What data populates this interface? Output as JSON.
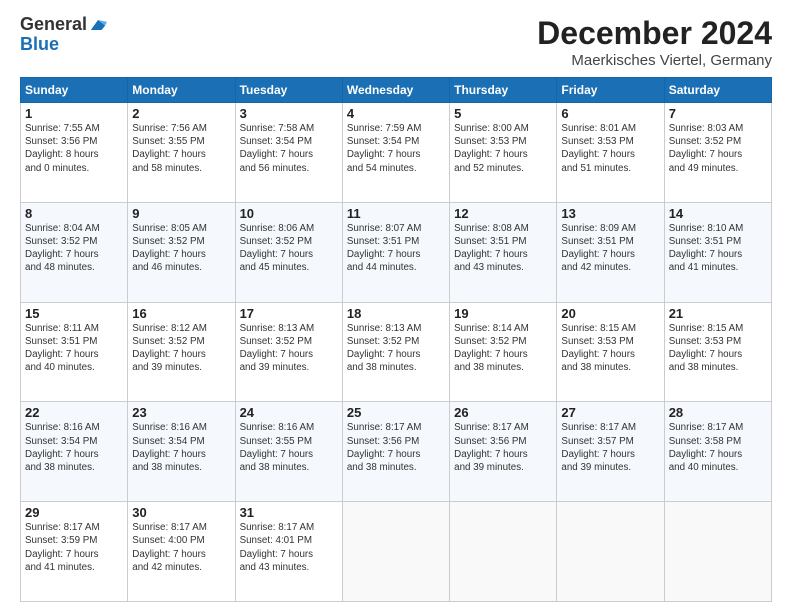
{
  "header": {
    "logo_general": "General",
    "logo_blue": "Blue",
    "main_title": "December 2024",
    "subtitle": "Maerkisches Viertel, Germany"
  },
  "weekdays": [
    "Sunday",
    "Monday",
    "Tuesday",
    "Wednesday",
    "Thursday",
    "Friday",
    "Saturday"
  ],
  "weeks": [
    [
      {
        "day": 1,
        "info": "Sunrise: 7:55 AM\nSunset: 3:56 PM\nDaylight: 8 hours\nand 0 minutes."
      },
      {
        "day": 2,
        "info": "Sunrise: 7:56 AM\nSunset: 3:55 PM\nDaylight: 7 hours\nand 58 minutes."
      },
      {
        "day": 3,
        "info": "Sunrise: 7:58 AM\nSunset: 3:54 PM\nDaylight: 7 hours\nand 56 minutes."
      },
      {
        "day": 4,
        "info": "Sunrise: 7:59 AM\nSunset: 3:54 PM\nDaylight: 7 hours\nand 54 minutes."
      },
      {
        "day": 5,
        "info": "Sunrise: 8:00 AM\nSunset: 3:53 PM\nDaylight: 7 hours\nand 52 minutes."
      },
      {
        "day": 6,
        "info": "Sunrise: 8:01 AM\nSunset: 3:53 PM\nDaylight: 7 hours\nand 51 minutes."
      },
      {
        "day": 7,
        "info": "Sunrise: 8:03 AM\nSunset: 3:52 PM\nDaylight: 7 hours\nand 49 minutes."
      }
    ],
    [
      {
        "day": 8,
        "info": "Sunrise: 8:04 AM\nSunset: 3:52 PM\nDaylight: 7 hours\nand 48 minutes."
      },
      {
        "day": 9,
        "info": "Sunrise: 8:05 AM\nSunset: 3:52 PM\nDaylight: 7 hours\nand 46 minutes."
      },
      {
        "day": 10,
        "info": "Sunrise: 8:06 AM\nSunset: 3:52 PM\nDaylight: 7 hours\nand 45 minutes."
      },
      {
        "day": 11,
        "info": "Sunrise: 8:07 AM\nSunset: 3:51 PM\nDaylight: 7 hours\nand 44 minutes."
      },
      {
        "day": 12,
        "info": "Sunrise: 8:08 AM\nSunset: 3:51 PM\nDaylight: 7 hours\nand 43 minutes."
      },
      {
        "day": 13,
        "info": "Sunrise: 8:09 AM\nSunset: 3:51 PM\nDaylight: 7 hours\nand 42 minutes."
      },
      {
        "day": 14,
        "info": "Sunrise: 8:10 AM\nSunset: 3:51 PM\nDaylight: 7 hours\nand 41 minutes."
      }
    ],
    [
      {
        "day": 15,
        "info": "Sunrise: 8:11 AM\nSunset: 3:51 PM\nDaylight: 7 hours\nand 40 minutes."
      },
      {
        "day": 16,
        "info": "Sunrise: 8:12 AM\nSunset: 3:52 PM\nDaylight: 7 hours\nand 39 minutes."
      },
      {
        "day": 17,
        "info": "Sunrise: 8:13 AM\nSunset: 3:52 PM\nDaylight: 7 hours\nand 39 minutes."
      },
      {
        "day": 18,
        "info": "Sunrise: 8:13 AM\nSunset: 3:52 PM\nDaylight: 7 hours\nand 38 minutes."
      },
      {
        "day": 19,
        "info": "Sunrise: 8:14 AM\nSunset: 3:52 PM\nDaylight: 7 hours\nand 38 minutes."
      },
      {
        "day": 20,
        "info": "Sunrise: 8:15 AM\nSunset: 3:53 PM\nDaylight: 7 hours\nand 38 minutes."
      },
      {
        "day": 21,
        "info": "Sunrise: 8:15 AM\nSunset: 3:53 PM\nDaylight: 7 hours\nand 38 minutes."
      }
    ],
    [
      {
        "day": 22,
        "info": "Sunrise: 8:16 AM\nSunset: 3:54 PM\nDaylight: 7 hours\nand 38 minutes."
      },
      {
        "day": 23,
        "info": "Sunrise: 8:16 AM\nSunset: 3:54 PM\nDaylight: 7 hours\nand 38 minutes."
      },
      {
        "day": 24,
        "info": "Sunrise: 8:16 AM\nSunset: 3:55 PM\nDaylight: 7 hours\nand 38 minutes."
      },
      {
        "day": 25,
        "info": "Sunrise: 8:17 AM\nSunset: 3:56 PM\nDaylight: 7 hours\nand 38 minutes."
      },
      {
        "day": 26,
        "info": "Sunrise: 8:17 AM\nSunset: 3:56 PM\nDaylight: 7 hours\nand 39 minutes."
      },
      {
        "day": 27,
        "info": "Sunrise: 8:17 AM\nSunset: 3:57 PM\nDaylight: 7 hours\nand 39 minutes."
      },
      {
        "day": 28,
        "info": "Sunrise: 8:17 AM\nSunset: 3:58 PM\nDaylight: 7 hours\nand 40 minutes."
      }
    ],
    [
      {
        "day": 29,
        "info": "Sunrise: 8:17 AM\nSunset: 3:59 PM\nDaylight: 7 hours\nand 41 minutes."
      },
      {
        "day": 30,
        "info": "Sunrise: 8:17 AM\nSunset: 4:00 PM\nDaylight: 7 hours\nand 42 minutes."
      },
      {
        "day": 31,
        "info": "Sunrise: 8:17 AM\nSunset: 4:01 PM\nDaylight: 7 hours\nand 43 minutes."
      },
      null,
      null,
      null,
      null
    ]
  ]
}
